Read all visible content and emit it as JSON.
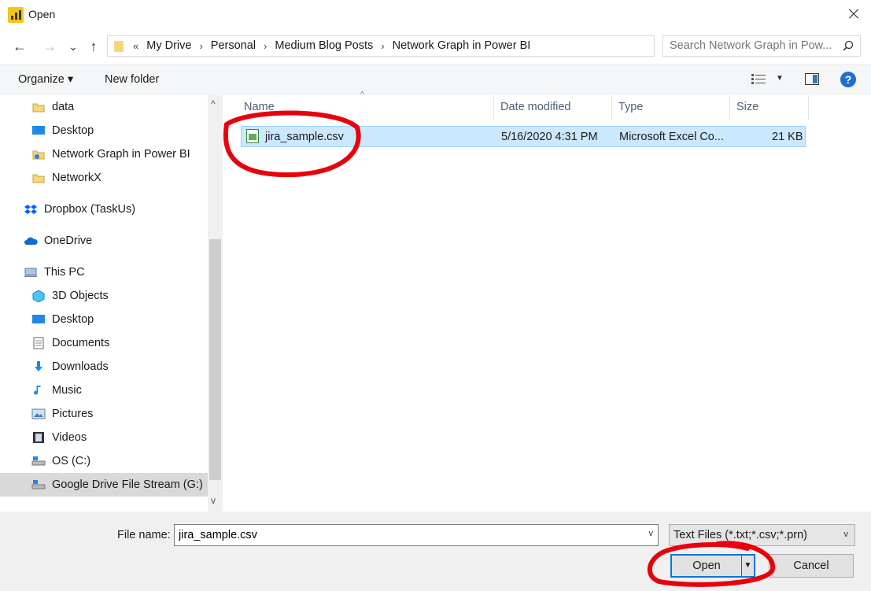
{
  "window": {
    "title": "Open"
  },
  "navigation": {
    "back_label": "←",
    "forward_label": "→",
    "recent_label": "⌄",
    "up_label": "↑",
    "overflow_label": "«",
    "breadcrumbs": [
      "My Drive",
      "Personal",
      "Medium Blog Posts",
      "Network Graph in Power BI"
    ],
    "separator": "›",
    "search_placeholder": "Search Network Graph in Pow..."
  },
  "toolbar": {
    "organize_label": "Organize ▾",
    "new_folder_label": "New folder",
    "help_label": "?"
  },
  "sidebar": {
    "items": [
      {
        "label": "data",
        "icon": "folder-icon"
      },
      {
        "label": "Desktop",
        "icon": "desktop-icon"
      },
      {
        "label": "Network Graph in Power BI",
        "icon": "shared-folder-icon"
      },
      {
        "label": "NetworkX",
        "icon": "folder-icon"
      },
      {
        "label": "Dropbox (TaskUs)",
        "icon": "dropbox-icon"
      },
      {
        "label": "OneDrive",
        "icon": "onedrive-icon"
      },
      {
        "label": "This PC",
        "icon": "computer-icon"
      },
      {
        "label": "3D Objects",
        "icon": "3d-objects-icon"
      },
      {
        "label": "Desktop",
        "icon": "desktop-icon"
      },
      {
        "label": "Documents",
        "icon": "documents-icon"
      },
      {
        "label": "Downloads",
        "icon": "download-icon"
      },
      {
        "label": "Music",
        "icon": "music-icon"
      },
      {
        "label": "Pictures",
        "icon": "pictures-icon"
      },
      {
        "label": "Videos",
        "icon": "videos-icon"
      },
      {
        "label": "OS (C:)",
        "icon": "drive-icon"
      },
      {
        "label": "Google Drive File Stream (G:)",
        "icon": "drive-icon"
      }
    ]
  },
  "file_list": {
    "columns": [
      "Name",
      "Date modified",
      "Type",
      "Size"
    ],
    "rows": [
      {
        "name": "jira_sample.csv",
        "date": "5/16/2020 4:31 PM",
        "type": "Microsoft Excel Co...",
        "size": "21 KB"
      }
    ]
  },
  "footer": {
    "filename_label": "File name:",
    "filename_value": "jira_sample.csv",
    "filetype_value": "Text Files (*.txt;*.csv;*.prn)",
    "open_label": "Open",
    "cancel_label": "Cancel"
  },
  "colors": {
    "accent": "#0078d7",
    "selection": "#cce8ff",
    "annotation": "#e8000d"
  }
}
